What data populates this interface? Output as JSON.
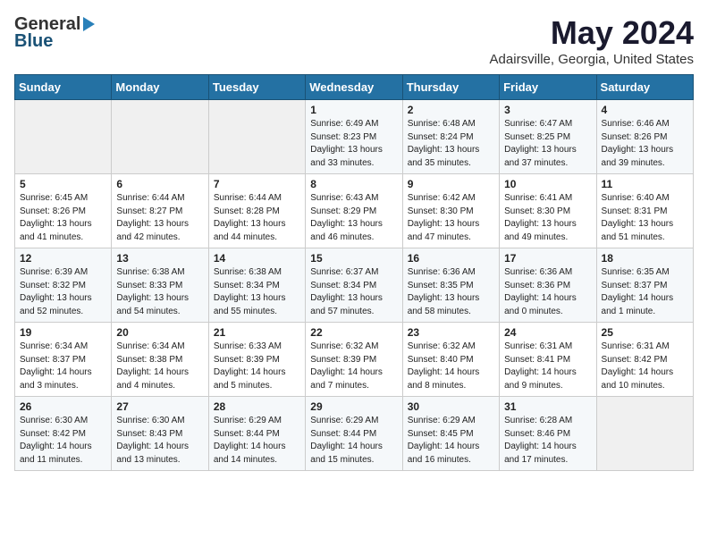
{
  "logo": {
    "general": "General",
    "blue": "Blue"
  },
  "title": "May 2024",
  "subtitle": "Adairsville, Georgia, United States",
  "weekdays": [
    "Sunday",
    "Monday",
    "Tuesday",
    "Wednesday",
    "Thursday",
    "Friday",
    "Saturday"
  ],
  "weeks": [
    [
      {
        "day": "",
        "info": ""
      },
      {
        "day": "",
        "info": ""
      },
      {
        "day": "",
        "info": ""
      },
      {
        "day": "1",
        "info": "Sunrise: 6:49 AM\nSunset: 8:23 PM\nDaylight: 13 hours\nand 33 minutes."
      },
      {
        "day": "2",
        "info": "Sunrise: 6:48 AM\nSunset: 8:24 PM\nDaylight: 13 hours\nand 35 minutes."
      },
      {
        "day": "3",
        "info": "Sunrise: 6:47 AM\nSunset: 8:25 PM\nDaylight: 13 hours\nand 37 minutes."
      },
      {
        "day": "4",
        "info": "Sunrise: 6:46 AM\nSunset: 8:26 PM\nDaylight: 13 hours\nand 39 minutes."
      }
    ],
    [
      {
        "day": "5",
        "info": "Sunrise: 6:45 AM\nSunset: 8:26 PM\nDaylight: 13 hours\nand 41 minutes."
      },
      {
        "day": "6",
        "info": "Sunrise: 6:44 AM\nSunset: 8:27 PM\nDaylight: 13 hours\nand 42 minutes."
      },
      {
        "day": "7",
        "info": "Sunrise: 6:44 AM\nSunset: 8:28 PM\nDaylight: 13 hours\nand 44 minutes."
      },
      {
        "day": "8",
        "info": "Sunrise: 6:43 AM\nSunset: 8:29 PM\nDaylight: 13 hours\nand 46 minutes."
      },
      {
        "day": "9",
        "info": "Sunrise: 6:42 AM\nSunset: 8:30 PM\nDaylight: 13 hours\nand 47 minutes."
      },
      {
        "day": "10",
        "info": "Sunrise: 6:41 AM\nSunset: 8:30 PM\nDaylight: 13 hours\nand 49 minutes."
      },
      {
        "day": "11",
        "info": "Sunrise: 6:40 AM\nSunset: 8:31 PM\nDaylight: 13 hours\nand 51 minutes."
      }
    ],
    [
      {
        "day": "12",
        "info": "Sunrise: 6:39 AM\nSunset: 8:32 PM\nDaylight: 13 hours\nand 52 minutes."
      },
      {
        "day": "13",
        "info": "Sunrise: 6:38 AM\nSunset: 8:33 PM\nDaylight: 13 hours\nand 54 minutes."
      },
      {
        "day": "14",
        "info": "Sunrise: 6:38 AM\nSunset: 8:34 PM\nDaylight: 13 hours\nand 55 minutes."
      },
      {
        "day": "15",
        "info": "Sunrise: 6:37 AM\nSunset: 8:34 PM\nDaylight: 13 hours\nand 57 minutes."
      },
      {
        "day": "16",
        "info": "Sunrise: 6:36 AM\nSunset: 8:35 PM\nDaylight: 13 hours\nand 58 minutes."
      },
      {
        "day": "17",
        "info": "Sunrise: 6:36 AM\nSunset: 8:36 PM\nDaylight: 14 hours\nand 0 minutes."
      },
      {
        "day": "18",
        "info": "Sunrise: 6:35 AM\nSunset: 8:37 PM\nDaylight: 14 hours\nand 1 minute."
      }
    ],
    [
      {
        "day": "19",
        "info": "Sunrise: 6:34 AM\nSunset: 8:37 PM\nDaylight: 14 hours\nand 3 minutes."
      },
      {
        "day": "20",
        "info": "Sunrise: 6:34 AM\nSunset: 8:38 PM\nDaylight: 14 hours\nand 4 minutes."
      },
      {
        "day": "21",
        "info": "Sunrise: 6:33 AM\nSunset: 8:39 PM\nDaylight: 14 hours\nand 5 minutes."
      },
      {
        "day": "22",
        "info": "Sunrise: 6:32 AM\nSunset: 8:39 PM\nDaylight: 14 hours\nand 7 minutes."
      },
      {
        "day": "23",
        "info": "Sunrise: 6:32 AM\nSunset: 8:40 PM\nDaylight: 14 hours\nand 8 minutes."
      },
      {
        "day": "24",
        "info": "Sunrise: 6:31 AM\nSunset: 8:41 PM\nDaylight: 14 hours\nand 9 minutes."
      },
      {
        "day": "25",
        "info": "Sunrise: 6:31 AM\nSunset: 8:42 PM\nDaylight: 14 hours\nand 10 minutes."
      }
    ],
    [
      {
        "day": "26",
        "info": "Sunrise: 6:30 AM\nSunset: 8:42 PM\nDaylight: 14 hours\nand 11 minutes."
      },
      {
        "day": "27",
        "info": "Sunrise: 6:30 AM\nSunset: 8:43 PM\nDaylight: 14 hours\nand 13 minutes."
      },
      {
        "day": "28",
        "info": "Sunrise: 6:29 AM\nSunset: 8:44 PM\nDaylight: 14 hours\nand 14 minutes."
      },
      {
        "day": "29",
        "info": "Sunrise: 6:29 AM\nSunset: 8:44 PM\nDaylight: 14 hours\nand 15 minutes."
      },
      {
        "day": "30",
        "info": "Sunrise: 6:29 AM\nSunset: 8:45 PM\nDaylight: 14 hours\nand 16 minutes."
      },
      {
        "day": "31",
        "info": "Sunrise: 6:28 AM\nSunset: 8:46 PM\nDaylight: 14 hours\nand 17 minutes."
      },
      {
        "day": "",
        "info": ""
      }
    ]
  ]
}
